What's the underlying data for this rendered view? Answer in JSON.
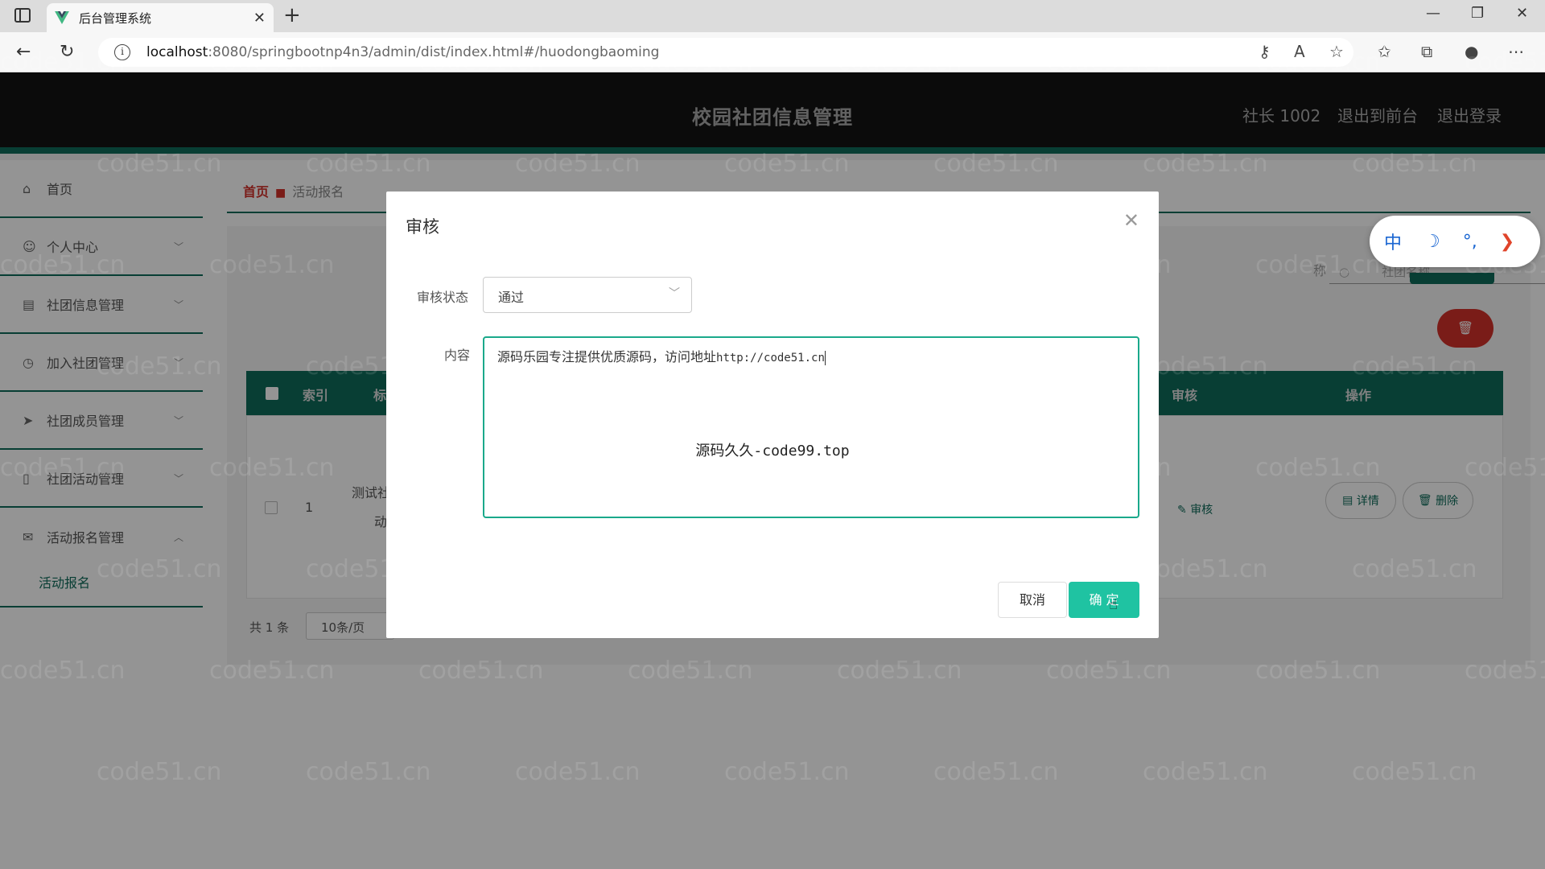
{
  "browser": {
    "tab_title": "后台管理系统",
    "url_host": "localhost",
    "url_path": ":8080/springbootnp4n3/admin/dist/index.html#/huodongbaoming"
  },
  "header": {
    "title": "校园社团信息管理",
    "user": "社长 1002",
    "to_front": "退出到前台",
    "logout": "退出登录"
  },
  "sidebar": {
    "items": [
      {
        "label": "首页",
        "icon": "home-icon"
      },
      {
        "label": "个人中心",
        "icon": "user-icon"
      },
      {
        "label": "社团信息管理",
        "icon": "clipboard-icon"
      },
      {
        "label": "加入社团管理",
        "icon": "clock-icon"
      },
      {
        "label": "社团成员管理",
        "icon": "send-icon"
      },
      {
        "label": "社团活动管理",
        "icon": "phone-icon"
      },
      {
        "label": "活动报名管理",
        "icon": "mail-icon"
      }
    ],
    "sub_item": "活动报名"
  },
  "breadcrumb": {
    "home": "首页",
    "current": "活动报名"
  },
  "search": {
    "label": "称",
    "placeholder": "社团名称"
  },
  "table": {
    "headers": [
      "索引",
      "标",
      "审核",
      "操作"
    ],
    "row": {
      "index": "1",
      "title_line1": "测试社",
      "title_line2": "动",
      "audit": "审核",
      "detail": "详情",
      "delete": "删除"
    }
  },
  "pager": {
    "total": "共 1 条",
    "page_size": "10条/页"
  },
  "dialog": {
    "title": "审核",
    "status_label": "审核状态",
    "status_value": "通过",
    "content_label": "内容",
    "content_text": "源码乐园专注提供优质源码，访问地址",
    "content_url": "http://code51.cn",
    "watermark_text": "源码久久-code99.top",
    "cancel": "取消",
    "confirm": "确 定"
  },
  "ime": {
    "lang": "中",
    "punct": "°,"
  },
  "watermark": "code51.cn",
  "colors": {
    "primary": "#0e6b5a",
    "confirm": "#1fc3a2",
    "danger": "#d2312a",
    "header_bg": "#141414"
  }
}
